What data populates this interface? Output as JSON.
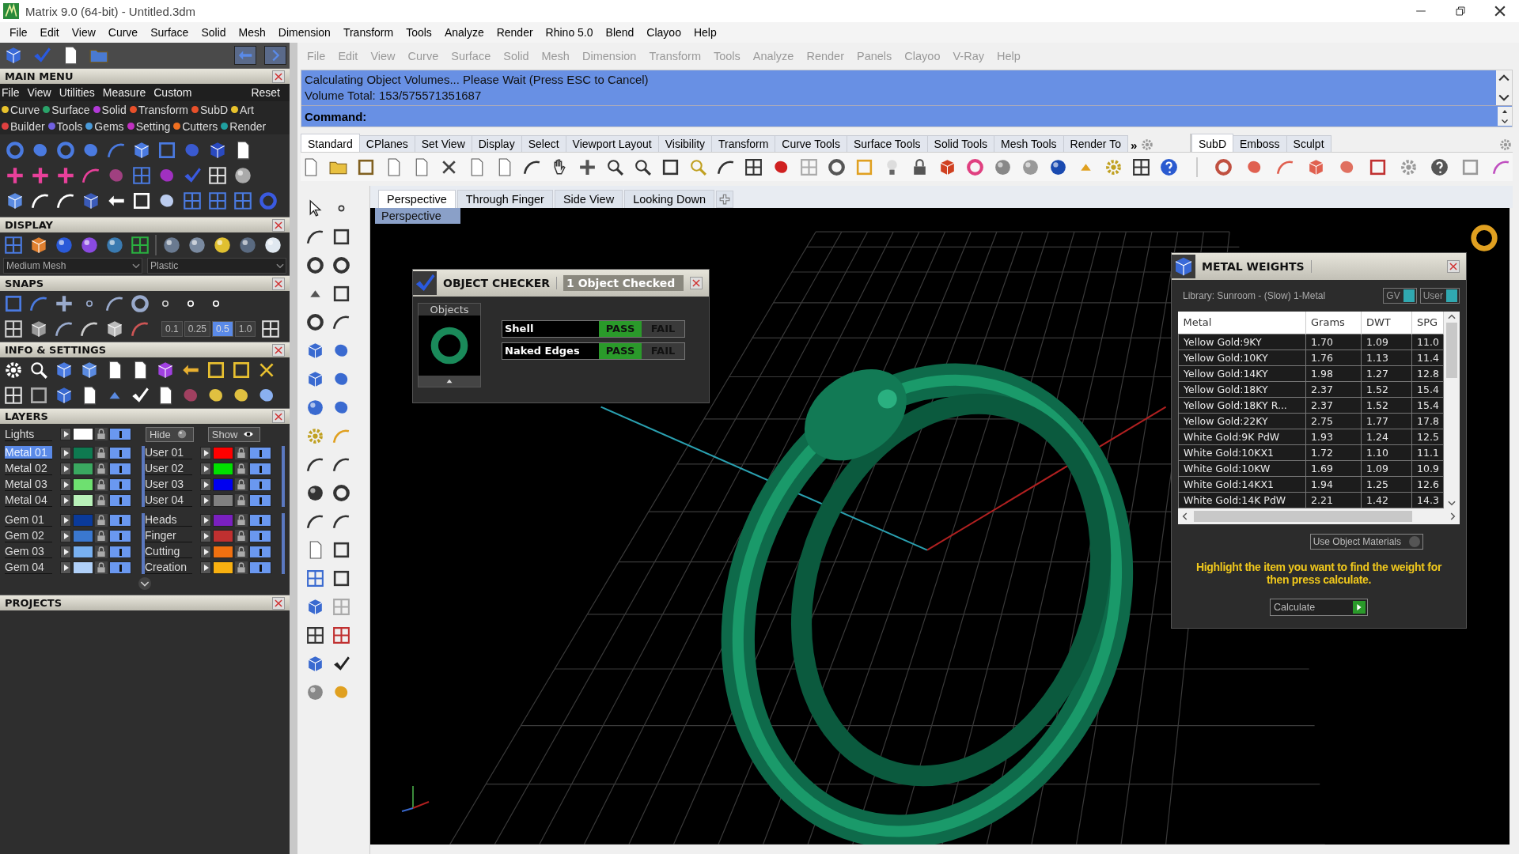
{
  "window": {
    "title": "Matrix 9.0 (64-bit) - Untitled.3dm"
  },
  "menu_bar": [
    "File",
    "Edit",
    "View",
    "Curve",
    "Surface",
    "Solid",
    "Mesh",
    "Dimension",
    "Transform",
    "Tools",
    "Analyze",
    "Render",
    "Rhino 5.0",
    "Blend",
    "Clayoo",
    "Help"
  ],
  "left_panel": {
    "main_menu": {
      "title": "MAIN MENU",
      "menu": [
        "File",
        "View",
        "Utilities",
        "Measure",
        "Custom"
      ],
      "reset": "Reset",
      "categories": [
        [
          {
            "label": "Curve",
            "color": "#e8c22c"
          },
          {
            "label": "Surface",
            "color": "#2aa36a"
          },
          {
            "label": "Solid",
            "color": "#b23ad8"
          },
          {
            "label": "Transform",
            "color": "#e8502a"
          },
          {
            "label": "SubD",
            "color": "#e8502a"
          },
          {
            "label": "Art",
            "color": "#e8c22c"
          }
        ],
        [
          {
            "label": "Builder",
            "color": "#e04040"
          },
          {
            "label": "Tools",
            "color": "#7060e0"
          },
          {
            "label": "Gems",
            "color": "#4a9ad8"
          },
          {
            "label": "Setting",
            "color": "#c030c0"
          },
          {
            "label": "Cutters",
            "color": "#f07020"
          },
          {
            "label": "Render",
            "color": "#20a0a0"
          }
        ]
      ]
    },
    "display": {
      "title": "DISPLAY",
      "mesh": "Medium Mesh",
      "material": "Plastic"
    },
    "snaps": {
      "title": "SNAPS",
      "steps": [
        {
          "label": "0.1",
          "selected": false
        },
        {
          "label": "0.25",
          "selected": false
        },
        {
          "label": "0.5",
          "selected": true
        },
        {
          "label": "1.0",
          "selected": false
        }
      ]
    },
    "info": {
      "title": "INFO & SETTINGS"
    },
    "layers": {
      "title": "LAYERS",
      "lights": {
        "name": "Lights",
        "color": "#ffffff",
        "visible": true
      },
      "hide": "Hide",
      "show": "Show",
      "groups": [
        [
          {
            "name": "Metal 01",
            "color": "#0e7a50",
            "selected": true,
            "visible": true
          },
          {
            "name": "Metal 02",
            "color": "#3aa860",
            "selected": false,
            "visible": true
          },
          {
            "name": "Metal 03",
            "color": "#6ee070",
            "selected": false,
            "visible": true
          },
          {
            "name": "Metal 04",
            "color": "#b8f0b8",
            "selected": false,
            "visible": true
          }
        ],
        [
          {
            "name": "User 01",
            "color": "#ff0000",
            "selected": false,
            "visible": true
          },
          {
            "name": "User 02",
            "color": "#00e000",
            "selected": false,
            "visible": true
          },
          {
            "name": "User 03",
            "color": "#0000f0",
            "selected": false,
            "visible": true
          },
          {
            "name": "User 04",
            "color": "#808080",
            "selected": false,
            "visible": true
          }
        ],
        [
          {
            "name": "Gem 01",
            "color": "#0a3a9a",
            "selected": false,
            "visible": true
          },
          {
            "name": "Gem 02",
            "color": "#3a78d0",
            "selected": false,
            "visible": true
          },
          {
            "name": "Gem 03",
            "color": "#78b0f0",
            "selected": false,
            "visible": true
          },
          {
            "name": "Gem 04",
            "color": "#b0d0f8",
            "selected": false,
            "visible": true
          }
        ],
        [
          {
            "name": "Heads",
            "color": "#7a20c0",
            "selected": false,
            "visible": true
          },
          {
            "name": "Finger",
            "color": "#c03030",
            "selected": false,
            "visible": true
          },
          {
            "name": "Cutting",
            "color": "#f07010",
            "selected": false,
            "visible": true
          },
          {
            "name": "Creation",
            "color": "#f8b010",
            "selected": false,
            "visible": true
          }
        ]
      ]
    },
    "projects": {
      "title": "PROJECTS"
    }
  },
  "rhino": {
    "menu": [
      "File",
      "Edit",
      "View",
      "Curve",
      "Surface",
      "Solid",
      "Mesh",
      "Dimension",
      "Transform",
      "Tools",
      "Analyze",
      "Render",
      "Panels",
      "Clayoo",
      "V-Ray",
      "Help"
    ],
    "command": {
      "lines": [
        "Calculating Object Volumes... Please Wait (Press ESC to Cancel)",
        "Volume Total: 153/575571351687"
      ],
      "prompt": "Command:"
    },
    "toolbar_tabs": [
      {
        "label": "Standard",
        "selected": true
      },
      {
        "label": "CPlanes",
        "selected": false
      },
      {
        "label": "Set View",
        "selected": false
      },
      {
        "label": "Display",
        "selected": false
      },
      {
        "label": "Select",
        "selected": false
      },
      {
        "label": "Viewport Layout",
        "selected": false
      },
      {
        "label": "Visibility",
        "selected": false
      },
      {
        "label": "Transform",
        "selected": false
      },
      {
        "label": "Curve Tools",
        "selected": false
      },
      {
        "label": "Surface Tools",
        "selected": false
      },
      {
        "label": "Solid Tools",
        "selected": false
      },
      {
        "label": "Mesh Tools",
        "selected": false
      },
      {
        "label": "Render To",
        "selected": false
      }
    ],
    "more": "»",
    "side_tabs": [
      {
        "label": "SubD",
        "selected": true
      },
      {
        "label": "Emboss",
        "selected": false
      },
      {
        "label": "Sculpt",
        "selected": false
      }
    ],
    "viewport_tabs": [
      {
        "label": "Perspective",
        "selected": true
      },
      {
        "label": "Through Finger",
        "selected": false
      },
      {
        "label": "Side View",
        "selected": false
      },
      {
        "label": "Looking Down",
        "selected": false
      }
    ],
    "viewport": {
      "label": "Perspective",
      "kind": "picture"
    }
  },
  "object_checker": {
    "title": "OBJECT CHECKER",
    "status": "1 Object Checked",
    "objects_label": "Objects",
    "checks": [
      {
        "name": "Shell",
        "pass": "PASS",
        "fail": "FAIL",
        "passed": true
      },
      {
        "name": "Naked Edges",
        "pass": "PASS",
        "fail": "FAIL",
        "passed": true
      }
    ]
  },
  "metal_weights": {
    "title": "METAL WEIGHTS",
    "library": "Library: Sunroom - (Slow) 1-Metal",
    "toggles": [
      {
        "label": "GV",
        "on": true
      },
      {
        "label": "User",
        "on": true
      }
    ],
    "columns": [
      "Metal",
      "Grams",
      "DWT",
      "SPG"
    ],
    "rows": [
      [
        "Yellow Gold:9KY",
        "1.70",
        "1.09",
        "11.0"
      ],
      [
        "Yellow Gold:10KY",
        "1.76",
        "1.13",
        "11.4"
      ],
      [
        "Yellow Gold:14KY",
        "1.98",
        "1.27",
        "12.8"
      ],
      [
        "Yellow Gold:18KY",
        "2.37",
        "1.52",
        "15.4"
      ],
      [
        "Yellow Gold:18KY R...",
        "2.37",
        "1.52",
        "15.4"
      ],
      [
        "Yellow Gold:22KY",
        "2.75",
        "1.77",
        "17.8"
      ],
      [
        "White Gold:9K PdW",
        "1.93",
        "1.24",
        "12.5"
      ],
      [
        "White Gold:10KX1",
        "1.72",
        "1.10",
        "11.1"
      ],
      [
        "White Gold:10KW",
        "1.69",
        "1.09",
        "10.9"
      ],
      [
        "White Gold:14KX1",
        "1.94",
        "1.25",
        "12.6"
      ],
      [
        "White Gold:14K PdW",
        "2.21",
        "1.42",
        "14.3"
      ]
    ],
    "use_materials": {
      "label": "Use Object Materials",
      "checked": false
    },
    "hint": "Highlight the item you want to find the weight for then press calculate.",
    "calculate": "Calculate"
  }
}
